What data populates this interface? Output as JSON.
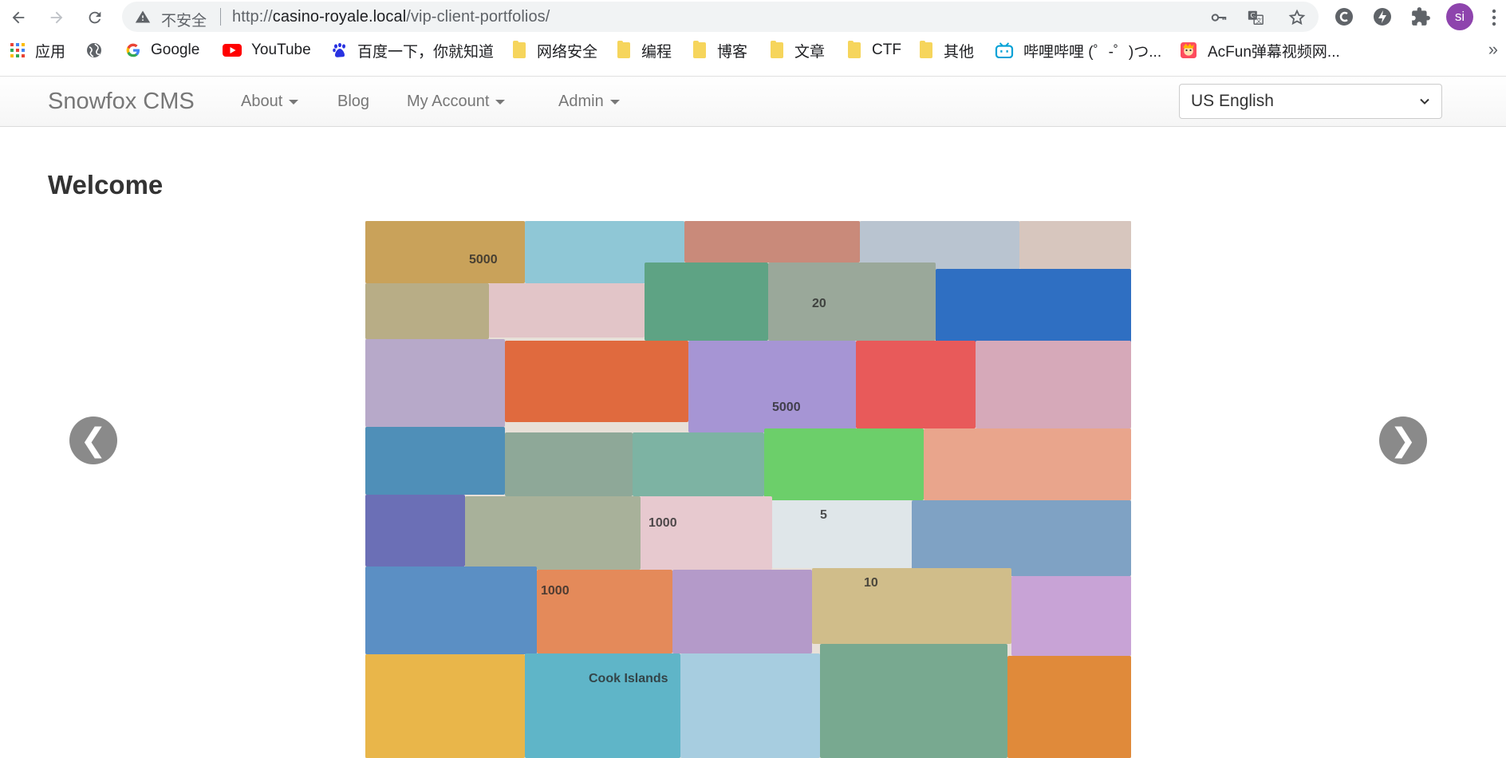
{
  "browser": {
    "security_label": "不安全",
    "url_scheme": "http://",
    "url_host": "casino-royale.local",
    "url_path": "/vip-client-portfolios/",
    "profile_initials": "si"
  },
  "bookmarks": [
    {
      "label": "应用",
      "icon": "apps-grid-icon"
    },
    {
      "label": "",
      "icon": "globe-icon"
    },
    {
      "label": "Google",
      "icon": "google-icon"
    },
    {
      "label": "YouTube",
      "icon": "youtube-icon"
    },
    {
      "label": "百度一下，你就知道",
      "icon": "baidu-icon"
    },
    {
      "label": "网络安全",
      "icon": "folder-icon"
    },
    {
      "label": "编程",
      "icon": "folder-icon"
    },
    {
      "label": "博客",
      "icon": "folder-icon"
    },
    {
      "label": "文章",
      "icon": "folder-icon"
    },
    {
      "label": "CTF",
      "icon": "folder-icon"
    },
    {
      "label": "其他",
      "icon": "folder-icon"
    },
    {
      "label": "哔哩哔哩 (゜-゜)つ...",
      "icon": "bilibili-icon"
    },
    {
      "label": "AcFun弹幕视频网...",
      "icon": "acfun-icon"
    }
  ],
  "bookmarks_more": "»",
  "site": {
    "brand": "Snowfox CMS",
    "nav": {
      "about": "About",
      "blog": "Blog",
      "my_account": "My Account",
      "admin": "Admin"
    },
    "language": "US English"
  },
  "main": {
    "title": "Welcome",
    "carousel": {
      "prev_label": "❮",
      "next_label": "❯",
      "image_alt": "world banknotes collage"
    }
  }
}
